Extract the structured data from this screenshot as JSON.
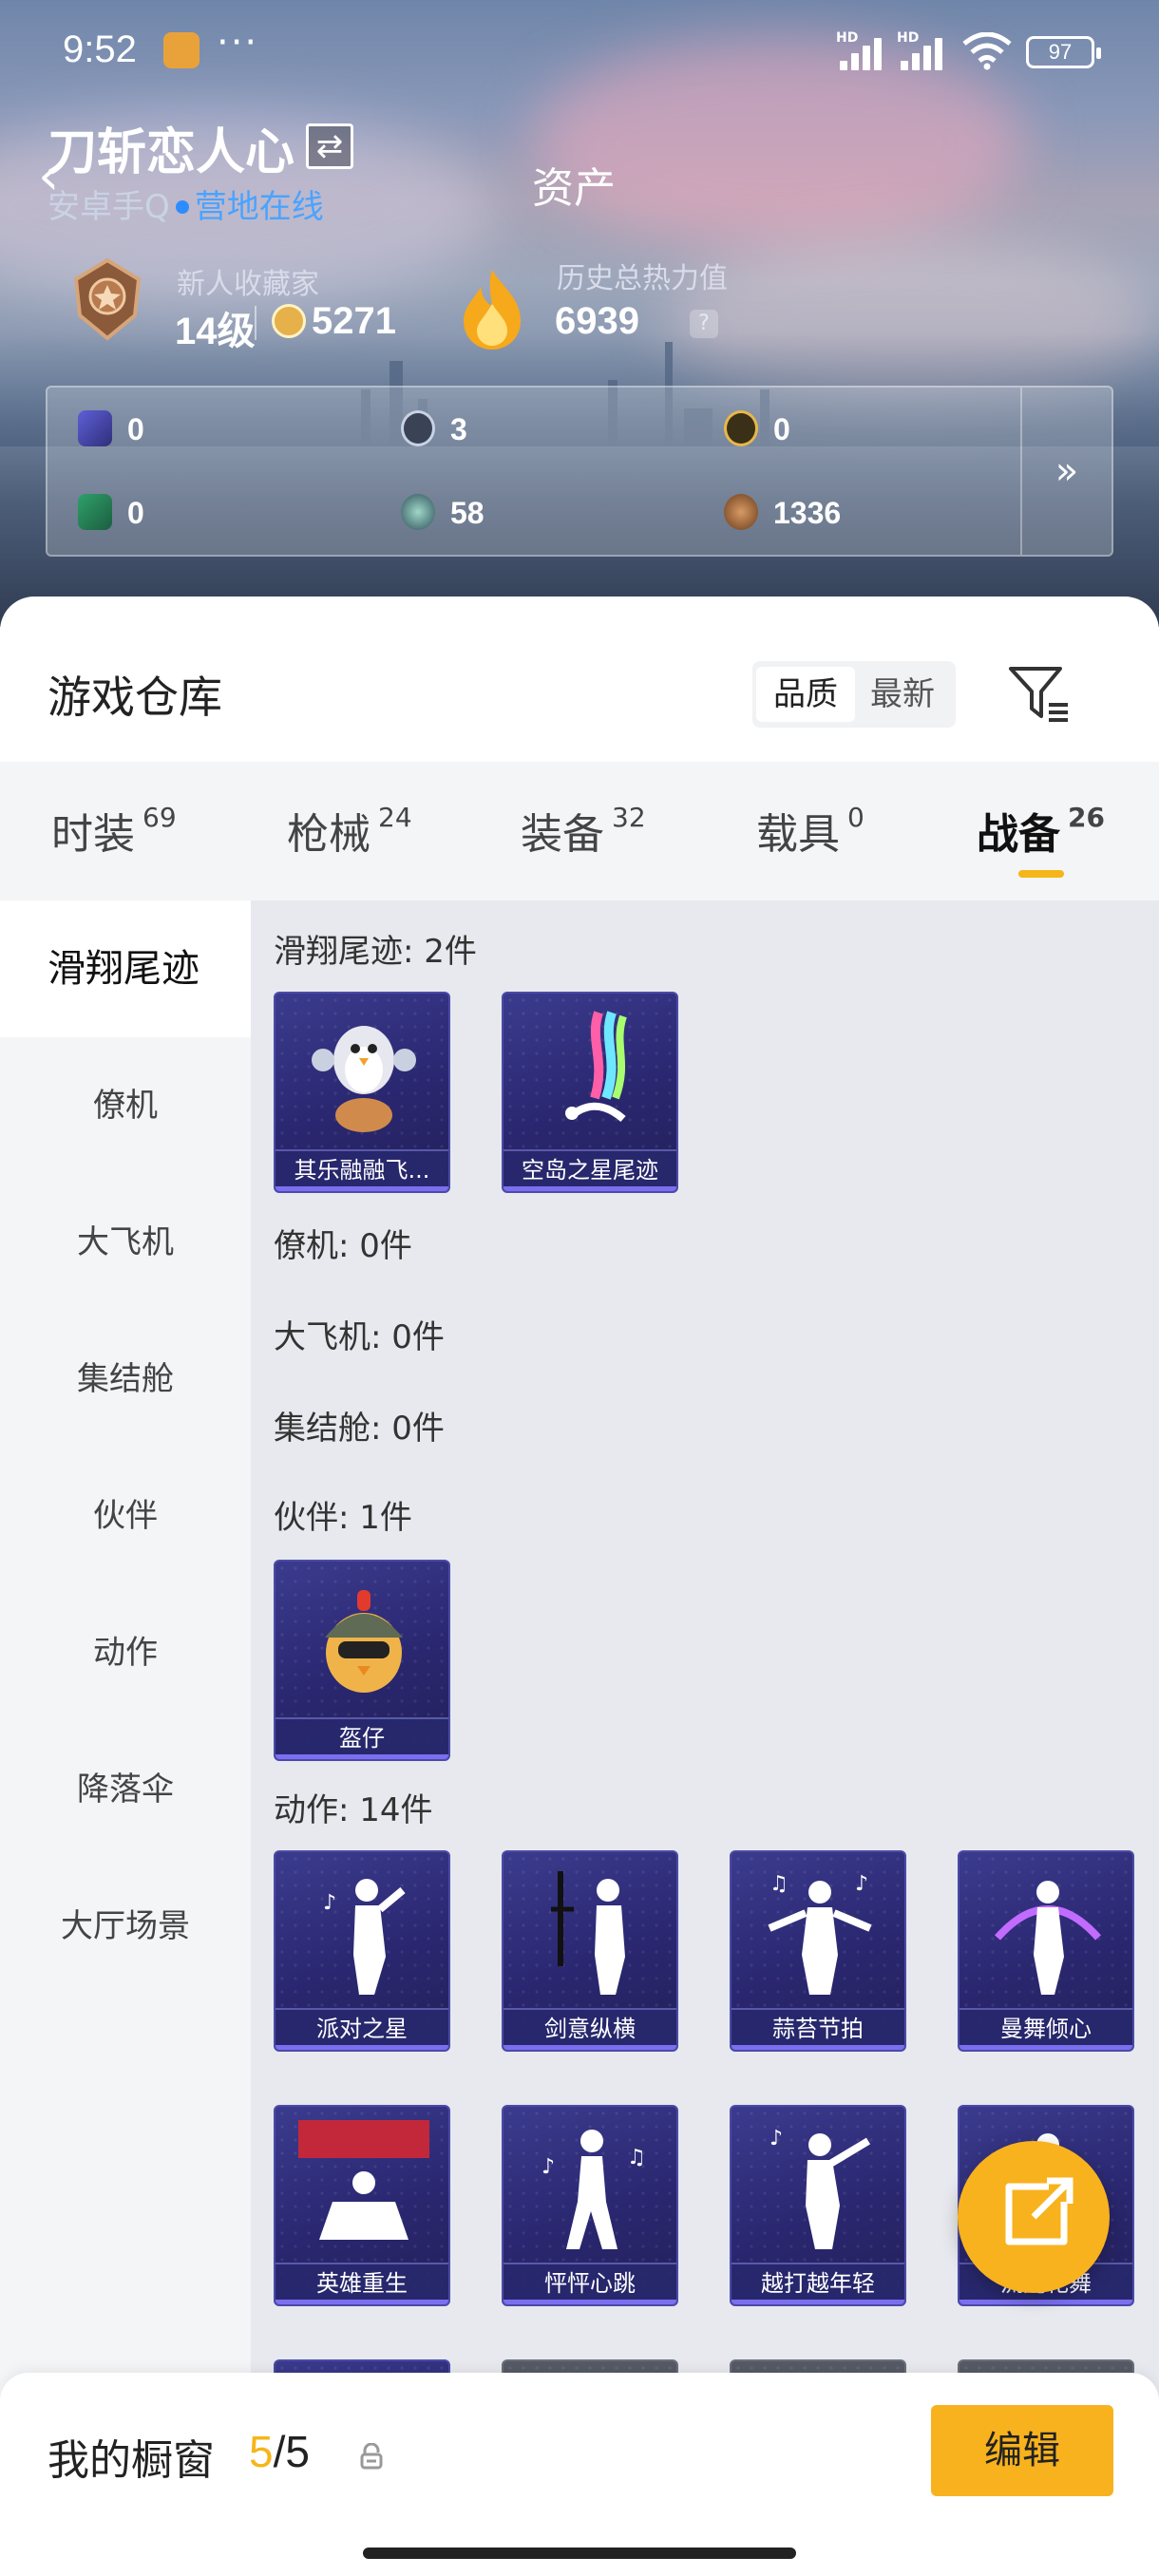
{
  "status_bar": {
    "time": "9:52",
    "more": "···",
    "signal_1_label": "HD",
    "signal_2_label": "HD",
    "battery": "97"
  },
  "header": {
    "player_name": "刀斩恋人心",
    "page_title": "资产",
    "platform": "安卓手Q",
    "online_status": "营地在线",
    "rank_title": "新人收藏家",
    "level": "14级",
    "coins": "5271",
    "heat_label": "历史总热力值",
    "heat_value": "6939",
    "help": "?"
  },
  "currencies": [
    {
      "icon": "card-ticket-icon",
      "value": "0"
    },
    {
      "icon": "silver-coin-icon",
      "value": "3"
    },
    {
      "icon": "gold-token-icon",
      "value": "0"
    },
    {
      "icon": "green-card-icon",
      "value": "0"
    },
    {
      "icon": "gem-icon",
      "value": "58"
    },
    {
      "icon": "bronze-coin-icon",
      "value": "1336"
    }
  ],
  "warehouse": {
    "title": "游戏仓库",
    "sort_options": [
      "品质",
      "最新"
    ],
    "sort_selected": "品质"
  },
  "tabs": [
    {
      "label": "时装",
      "count": "69"
    },
    {
      "label": "枪械",
      "count": "24"
    },
    {
      "label": "装备",
      "count": "32"
    },
    {
      "label": "载具",
      "count": "0"
    },
    {
      "label": "战备",
      "count": "26",
      "active": true
    }
  ],
  "sidebar": [
    "滑翔尾迹",
    "僚机",
    "大飞机",
    "集结舱",
    "伙伴",
    "动作",
    "降落伞",
    "大厅场景"
  ],
  "sections": {
    "glide": {
      "title": "滑翔尾迹: 2件",
      "items": [
        "其乐融融飞...",
        "空岛之星尾迹"
      ]
    },
    "wingman": {
      "title": "僚机: 0件"
    },
    "plane": {
      "title": "大飞机: 0件"
    },
    "pod": {
      "title": "集结舱: 0件"
    },
    "buddy": {
      "title": "伙伴: 1件",
      "items": [
        "盔仔"
      ]
    },
    "emote": {
      "title": "动作: 14件",
      "items": [
        "派对之星",
        "剑意纵横",
        "蒜苔节拍",
        "曼舞倾心",
        "英雄重生",
        "怦怦心跳",
        "越打越年轻",
        "流光花舞"
      ]
    }
  },
  "footer": {
    "title": "我的橱窗",
    "count_current": "5",
    "count_sep": "/",
    "count_total": "5",
    "edit_label": "编辑"
  },
  "colors": {
    "accent": "#f8b21d",
    "online": "#4aa3ff",
    "card_bg": "#2a2770"
  }
}
